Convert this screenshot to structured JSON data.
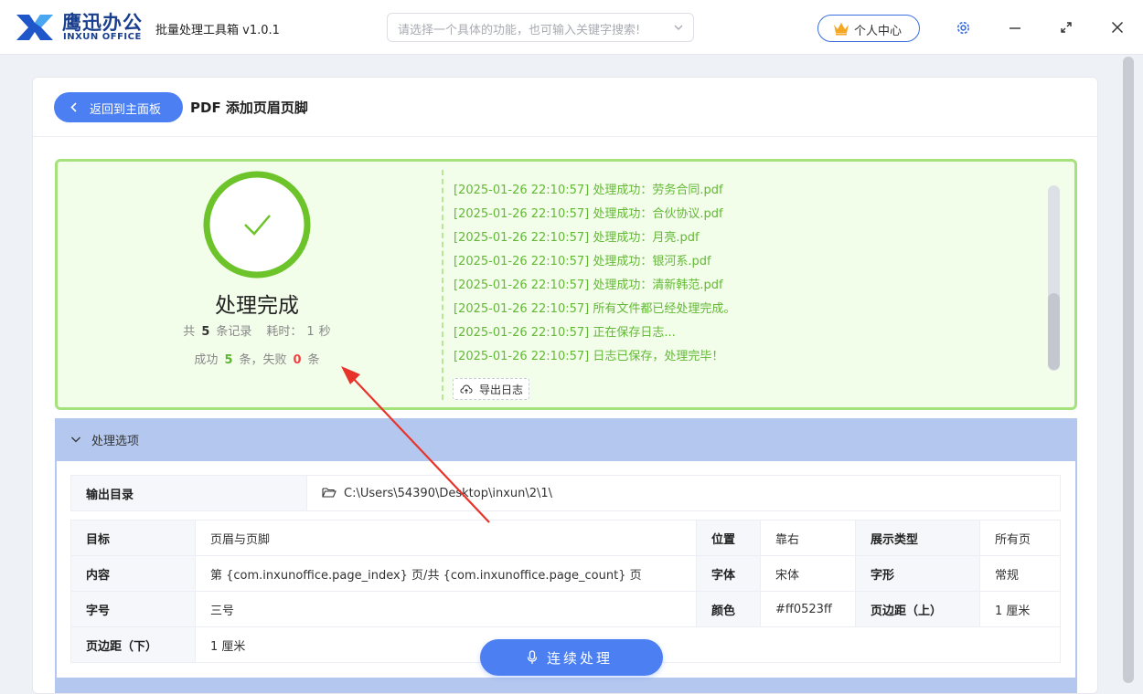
{
  "header": {
    "brand_cn": "鹰迅办公",
    "brand_en": "INXUN OFFICE",
    "app_title": "批量处理工具箱 v1.0.1",
    "search_placeholder": "请选择一个具体的功能，也可输入关键字搜索!",
    "user_center": "个人中心",
    "icons": [
      "logo-icon",
      "chevron-down-icon",
      "crown-icon",
      "gear-icon",
      "minimize-icon",
      "maximize-icon",
      "close-icon"
    ]
  },
  "page": {
    "back_label": "返回到主面板",
    "title": "PDF 添加页眉页脚"
  },
  "result": {
    "status_title": "处理完成",
    "total_prefix": "共",
    "total": "5",
    "total_suffix": "条记录",
    "time_prefix": "耗时：",
    "time_value": "1",
    "time_unit": "秒",
    "success_prefix": "成功",
    "success": "5",
    "fail_prefix": "条，失败",
    "fail": "0",
    "fail_suffix": "条",
    "logs": [
      "[2025-01-26 22:10:57] 处理成功：劳务合同.pdf",
      "[2025-01-26 22:10:57] 处理成功：合伙协议.pdf",
      "[2025-01-26 22:10:57] 处理成功：月亮.pdf",
      "[2025-01-26 22:10:57] 处理成功：银河系.pdf",
      "[2025-01-26 22:10:57] 处理成功：清新韩范.pdf",
      "[2025-01-26 22:10:57] 所有文件都已经处理完成。",
      "[2025-01-26 22:10:57] 正在保存日志...",
      "[2025-01-26 22:10:57] 日志已保存，处理完毕！"
    ],
    "export_label": "导出日志",
    "colors": {
      "success": "#63b935",
      "fail": "#ee4444",
      "panel_bg": "#f2fdea",
      "panel_border": "#a6e27c"
    }
  },
  "options": {
    "title": "处理选项",
    "output_dir_label": "输出目录",
    "output_dir_value": "C:\\Users\\54390\\Desktop\\inxun\\2\\1\\",
    "rows": [
      [
        "目标",
        "页眉与页脚",
        "位置",
        "靠右",
        "展示类型",
        "所有页"
      ],
      [
        "内容",
        "第 {com.inxunoffice.page_index} 页/共 {com.inxunoffice.page_count} 页",
        "字体",
        "宋体",
        "字形",
        "常规"
      ],
      [
        "字号",
        "三号",
        "颜色",
        "#ff0523ff",
        "页边距（上）",
        "1 厘米"
      ],
      [
        "页边距（下）",
        "1 厘米"
      ]
    ]
  },
  "actions": {
    "continue_label": "连续处理",
    "accent": "#4b7ff2"
  }
}
